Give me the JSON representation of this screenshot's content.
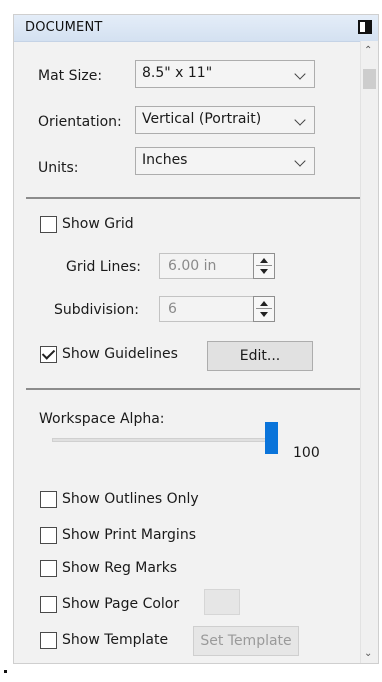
{
  "header": {
    "title": "DOCUMENT"
  },
  "mat_size": {
    "label": "Mat Size:",
    "value": "8.5\" x 11\""
  },
  "orientation": {
    "label": "Orientation:",
    "value": "Vertical (Portrait)"
  },
  "units": {
    "label": "Units:",
    "value": "Inches"
  },
  "grid": {
    "show_label": "Show Grid",
    "show_checked": false,
    "lines_label": "Grid Lines:",
    "lines_value": "6.00 in",
    "subdivision_label": "Subdivision:",
    "subdivision_value": "6"
  },
  "guidelines": {
    "label": "Show Guidelines",
    "checked": true,
    "edit_label": "Edit..."
  },
  "workspace_alpha": {
    "label": "Workspace Alpha:",
    "value": "100",
    "level_percent": 100
  },
  "options": {
    "outlines_only": "Show Outlines Only",
    "print_margins": "Show Print Margins",
    "reg_marks": "Show Reg Marks",
    "page_color": "Show Page Color",
    "template": "Show Template",
    "set_template": "Set Template"
  },
  "colors": {
    "accent": "#0a74da",
    "header_bg": "#d4e1f1",
    "panel_bg": "#f2f2f2"
  }
}
